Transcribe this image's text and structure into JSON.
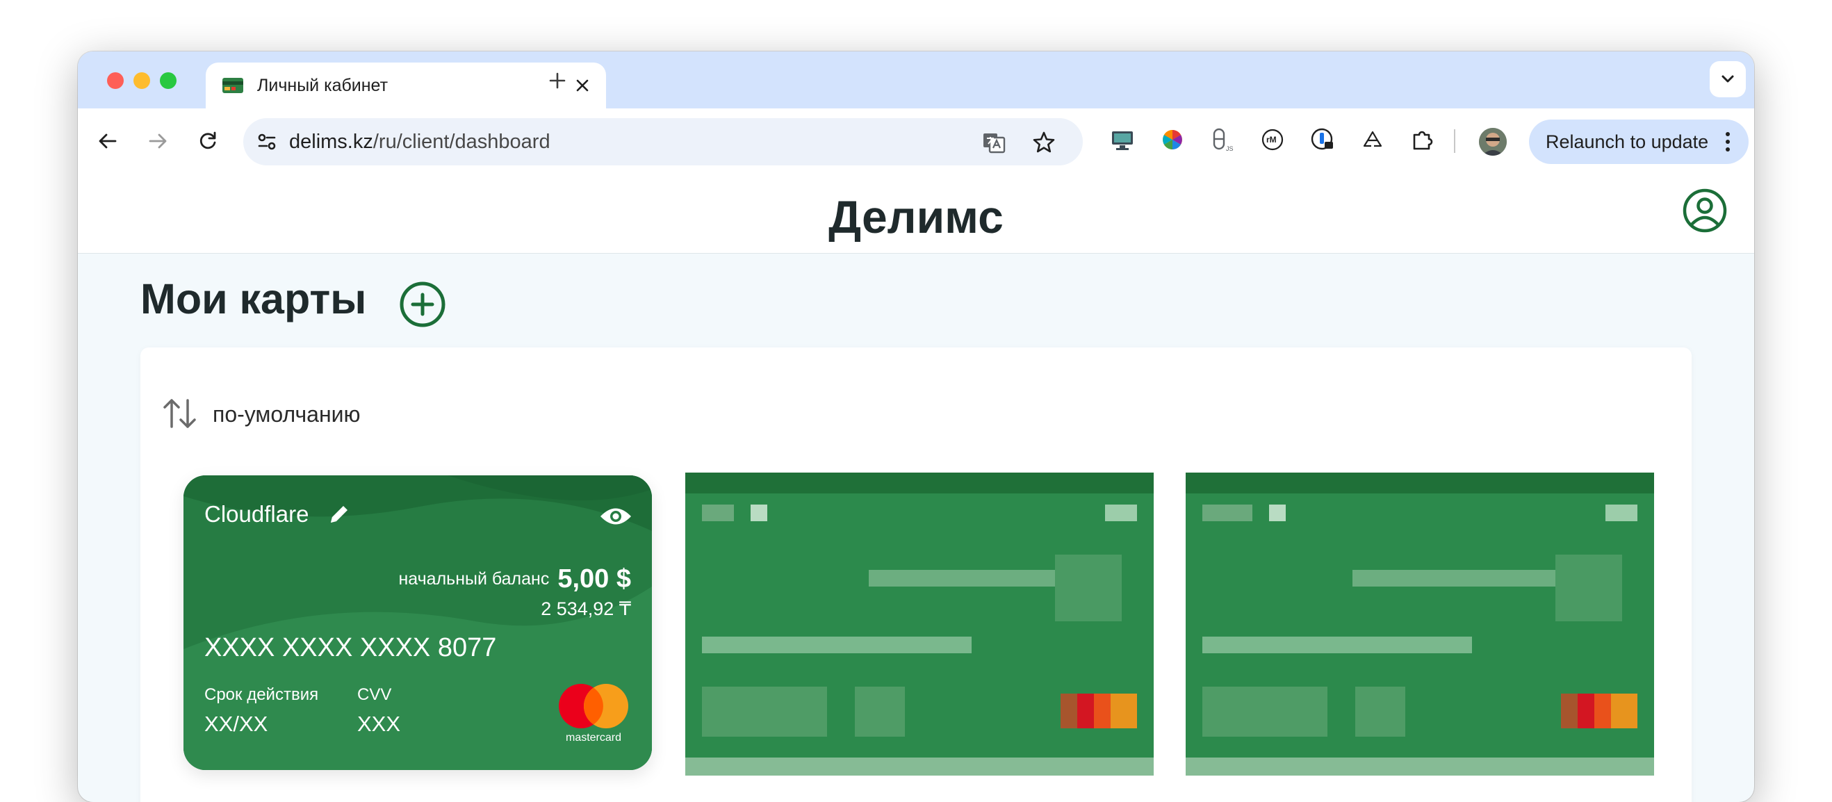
{
  "browser": {
    "tab_title": "Личный кабинет",
    "url_host": "delims.kz",
    "url_path": "/ru/client/dashboard",
    "relaunch_label": "Relaunch to update"
  },
  "site": {
    "brand": "Делимс"
  },
  "page": {
    "title": "Мои карты",
    "sort_label": "по-умолчанию"
  },
  "card": {
    "name": "Cloudflare",
    "balance_label": "начальный баланс",
    "balance_value": "5,00 $",
    "balance_secondary": "2 534,92 ₸",
    "number": "XXXX XXXX XXXX 8077",
    "expiry_label": "Срок действия",
    "expiry_value": "XX/XX",
    "cvv_label": "CVV",
    "cvv_value": "XXX",
    "network": "mastercard",
    "color": "#2a8148"
  },
  "blurred_cards_count": 2,
  "colors": {
    "brand_green": "#1b6e38",
    "card_green": "#2a8148"
  }
}
